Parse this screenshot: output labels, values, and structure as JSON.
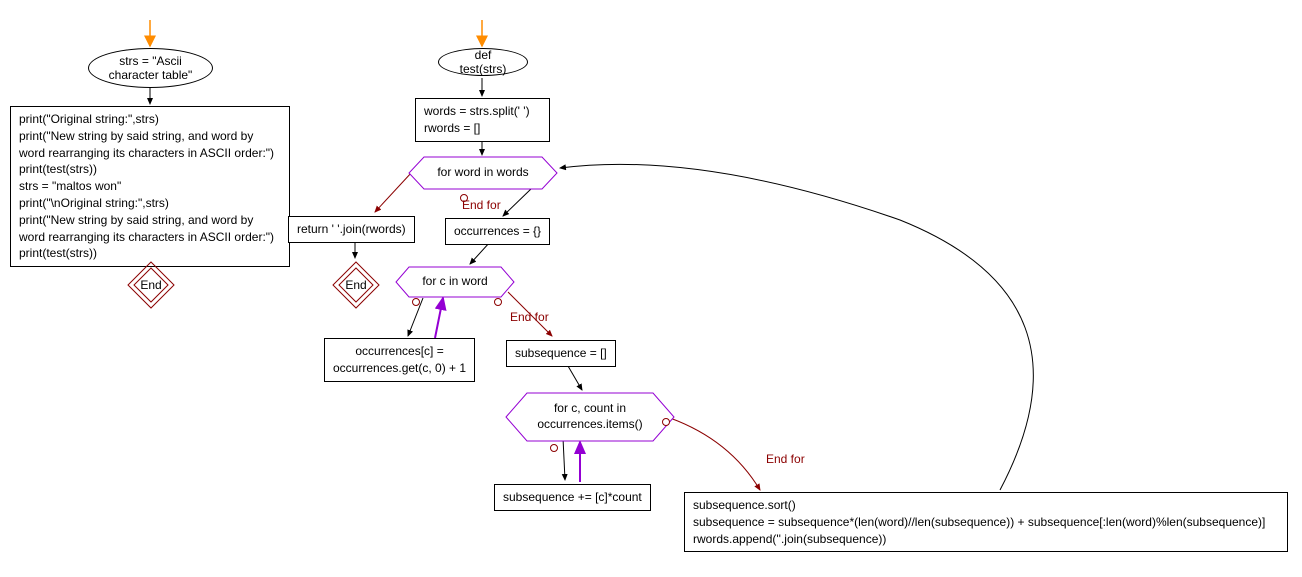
{
  "nodes": {
    "left_ellipse": "strs = \"Ascii\ncharacter table\"",
    "left_block": "print(\"Original string:\",strs)\nprint(\"New string by said string, and word by\nword rearranging its characters in ASCII order:\")\nprint(test(strs))\nstrs = \"maltos won\"\nprint(\"\\nOriginal string:\",strs)\nprint(\"New string by said string, and word by\nword rearranging its characters in ASCII order:\")\nprint(test(strs))",
    "end1": "End",
    "def_test": "def test(strs)",
    "split_block": "words = strs.split(' ')\nrwords = []",
    "for_words": "for word in words",
    "return_join": "return ' '.join(rwords)",
    "end2": "End",
    "occurrences_init": "occurrences = {}",
    "for_c": "for c in word",
    "occ_update": "occurrences[c] =\noccurrences.get(c, 0) + 1",
    "subseq_init": "subsequence = []",
    "for_items": "for c, count in\noccurrences.items()",
    "subseq_append": "subsequence += [c]*count",
    "final_block": "subsequence.sort()\nsubsequence = subsequence*(len(word)//len(subsequence)) + subsequence[:len(word)%len(subsequence)]\nrwords.append(''.join(subsequence))"
  },
  "labels": {
    "endfor1": "End for",
    "endfor2": "End for",
    "endfor3": "End for"
  },
  "colors": {
    "orange_arrow": "#ff8c00",
    "purple": "#9400d3",
    "darkred": "#8b0000"
  }
}
